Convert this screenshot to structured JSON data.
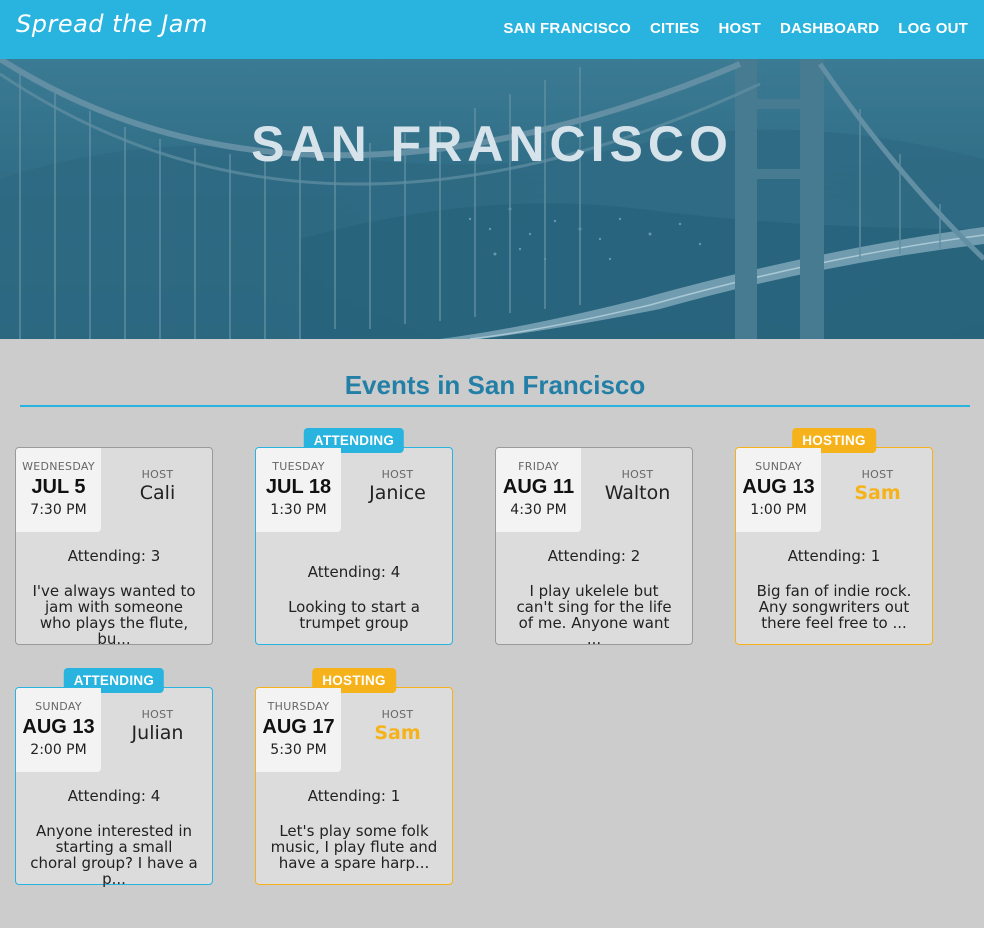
{
  "brand": "Spread the Jam",
  "nav": {
    "links": [
      "SAN FRANCISCO",
      "CITIES",
      "HOST",
      "DASHBOARD",
      "LOG OUT"
    ]
  },
  "hero": {
    "title": "SAN FRANCISCO"
  },
  "section": {
    "title": "Events in San Francisco"
  },
  "colors": {
    "brand_blue": "#29b3df",
    "heading_blue": "#237fa6",
    "hosting_orange": "#f5b21a",
    "page_bg": "#cccccc"
  },
  "events": [
    {
      "badge": "",
      "weekday": "WEDNESDAY",
      "date": "JUL 5",
      "time": "7:30 PM",
      "host_label": "HOST",
      "host": "Cali",
      "attending": "Attending: 3",
      "description": "I've always wanted to jam with someone who plays the flute, bu..."
    },
    {
      "badge": "ATTENDING",
      "weekday": "TUESDAY",
      "date": "JUL 18",
      "time": "1:30 PM",
      "host_label": "HOST",
      "host": "Janice",
      "attending": "Attending: 4",
      "description": "Looking to start a trumpet group"
    },
    {
      "badge": "",
      "weekday": "FRIDAY",
      "date": "AUG 11",
      "time": "4:30 PM",
      "host_label": "HOST",
      "host": "Walton",
      "attending": "Attending: 2",
      "description": "I play ukelele but can't sing for the life of me. Anyone want ..."
    },
    {
      "badge": "HOSTING",
      "weekday": "SUNDAY",
      "date": "AUG 13",
      "time": "1:00 PM",
      "host_label": "HOST",
      "host": "Sam",
      "attending": "Attending: 1",
      "description": "Big fan of indie rock. Any songwriters out there feel free to ..."
    },
    {
      "badge": "ATTENDING",
      "weekday": "SUNDAY",
      "date": "AUG 13",
      "time": "2:00 PM",
      "host_label": "HOST",
      "host": "Julian",
      "attending": "Attending: 4",
      "description": "Anyone interested in starting a small choral group? I have a p..."
    },
    {
      "badge": "HOSTING",
      "weekday": "THURSDAY",
      "date": "AUG 17",
      "time": "5:30 PM",
      "host_label": "HOST",
      "host": "Sam",
      "attending": "Attending: 1",
      "description": "Let's play some folk music, I play flute and have a spare harp..."
    }
  ]
}
